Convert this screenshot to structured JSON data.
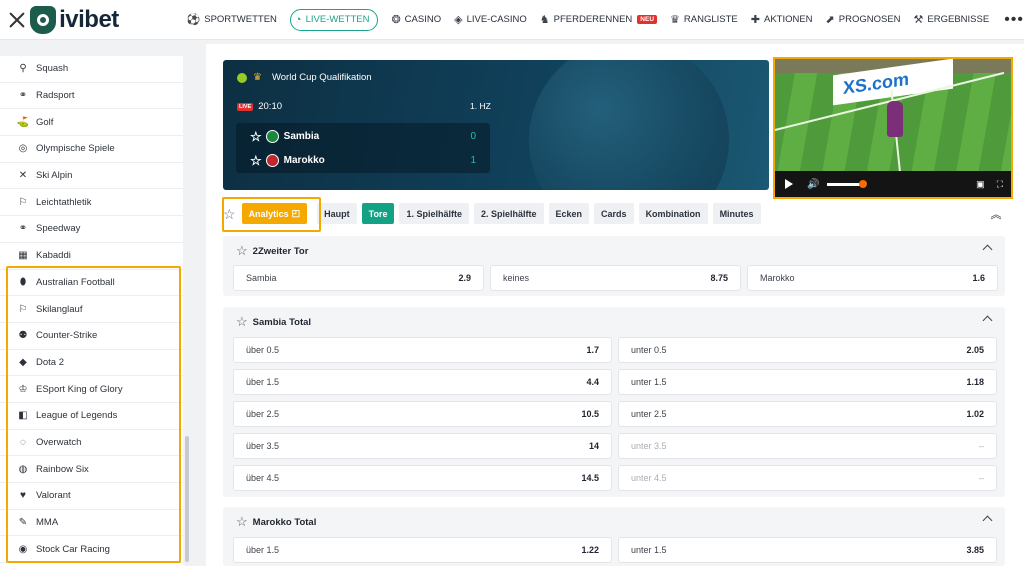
{
  "brand": {
    "name": "ivibet"
  },
  "nav": [
    {
      "icon": "⚽",
      "label": "SPORTWETTEN"
    },
    {
      "icon": "◔",
      "label": "LIVE-WETTEN",
      "active": true
    },
    {
      "icon": "❂",
      "label": "CASINO"
    },
    {
      "icon": "◈",
      "label": "LIVE-CASINO"
    },
    {
      "icon": "♞",
      "label": "PFERDERENNEN"
    },
    {
      "icon": "",
      "label": "",
      "badge": "NEU"
    },
    {
      "icon": "♛",
      "label": "RANGLISTE"
    },
    {
      "icon": "✚",
      "label": "AKTIONEN"
    },
    {
      "icon": "⬈",
      "label": "PROGNOSEN"
    },
    {
      "icon": "⚒",
      "label": "ERGEBNISSE"
    }
  ],
  "more": "•••",
  "sidebar": {
    "items": [
      {
        "icon": "⚲",
        "label": "Squash"
      },
      {
        "icon": "⚭",
        "label": "Radsport"
      },
      {
        "icon": "⛳",
        "label": "Golf"
      },
      {
        "icon": "◎",
        "label": "Olympische Spiele"
      },
      {
        "icon": "✕",
        "label": "Ski Alpin"
      },
      {
        "icon": "⚐",
        "label": "Leichtathletik"
      },
      {
        "icon": "⚭",
        "label": "Speedway"
      },
      {
        "icon": "▦",
        "label": "Kabaddi"
      },
      {
        "icon": "⬮",
        "label": "Australian Football"
      },
      {
        "icon": "⚐",
        "label": "Skilanglauf"
      },
      {
        "icon": "⚉",
        "label": "Counter-Strike"
      },
      {
        "icon": "◆",
        "label": "Dota 2"
      },
      {
        "icon": "♔",
        "label": "ESport King of Glory"
      },
      {
        "icon": "◧",
        "label": "League of Legends"
      },
      {
        "icon": "◌",
        "label": "Overwatch"
      },
      {
        "icon": "◍",
        "label": "Rainbow Six"
      },
      {
        "icon": "♥",
        "label": "Valorant"
      },
      {
        "icon": "✎",
        "label": "MMA"
      },
      {
        "icon": "◉",
        "label": "Stock Car Racing"
      }
    ]
  },
  "match": {
    "competition": "World Cup Qualifikation",
    "live_label": "LIVE",
    "time": "20:10",
    "period": "1. HZ",
    "teams": [
      {
        "name": "Sambia",
        "score": "0",
        "flag_color": "#198a3c"
      },
      {
        "name": "Marokko",
        "score": "1",
        "flag_color": "#c1272d"
      }
    ]
  },
  "video": {
    "board_text": "XS.com"
  },
  "tabs": [
    "Analytics",
    "Haupt",
    "Tore",
    "1. Spielhälfte",
    "2. Spielhälfte",
    "Ecken",
    "Cards",
    "Kombination",
    "Minutes"
  ],
  "markets": [
    {
      "title": "2Zweiter Tor",
      "odds": [
        {
          "label": "Sambia",
          "value": "2.9"
        },
        {
          "label": "keines",
          "value": "8.75"
        },
        {
          "label": "Marokko",
          "value": "1.6"
        }
      ]
    },
    {
      "title": "Sambia Total",
      "rows": [
        [
          {
            "label": "über 0.5",
            "value": "1.7"
          },
          {
            "label": "unter 0.5",
            "value": "2.05"
          }
        ],
        [
          {
            "label": "über 1.5",
            "value": "4.4"
          },
          {
            "label": "unter 1.5",
            "value": "1.18"
          }
        ],
        [
          {
            "label": "über 2.5",
            "value": "10.5"
          },
          {
            "label": "unter 2.5",
            "value": "1.02"
          }
        ],
        [
          {
            "label": "über 3.5",
            "value": "14"
          },
          {
            "label": "unter 3.5",
            "value": "–",
            "locked": true
          }
        ],
        [
          {
            "label": "über 4.5",
            "value": "14.5"
          },
          {
            "label": "unter 4.5",
            "value": "–",
            "locked": true
          }
        ]
      ]
    },
    {
      "title": "Marokko Total",
      "rows": [
        [
          {
            "label": "über 1.5",
            "value": "1.22"
          },
          {
            "label": "unter 1.5",
            "value": "3.85"
          }
        ]
      ]
    }
  ]
}
